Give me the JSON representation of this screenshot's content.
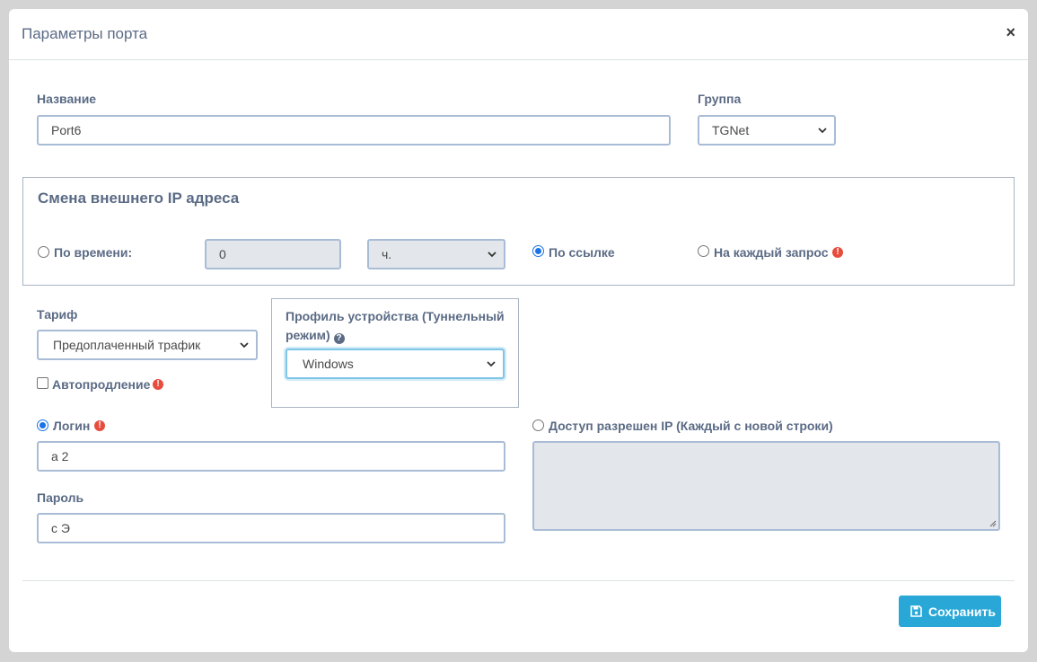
{
  "modal": {
    "title": "Параметры порта",
    "close_glyph": "×"
  },
  "name_field": {
    "label": "Название",
    "value": "Port6"
  },
  "group_field": {
    "label": "Группа",
    "selected": "TGNet"
  },
  "ip_change": {
    "title": "Смена внешнего IP адреса",
    "by_time_label": "По времени:",
    "time_value": "0",
    "time_unit_selected": "ч.",
    "by_link_label": "По ссылке",
    "per_request_label": "На каждый запрос",
    "selected_option": "by_link"
  },
  "tariff": {
    "label": "Тариф",
    "selected": "Предоплаченный трафик",
    "auto_renew_label": "Автопродление",
    "auto_renew_checked": false
  },
  "device_profile": {
    "label": "Профиль устройства (Туннельный режим)",
    "selected": "Windows"
  },
  "auth": {
    "login_label": "Логин",
    "login_value": "a          2",
    "password_label": "Пароль",
    "password_value": "c      Э",
    "ip_access_label": "Доступ разрешен IP (Каждый с новой строки)",
    "selected_mode": "login"
  },
  "footer": {
    "save_label": "Сохранить"
  },
  "colors": {
    "accent": "#29a8d8",
    "warning": "#e74c3c",
    "radio_checked": "#1a73e8"
  },
  "icons": {
    "close": "close-icon",
    "warning": "exclamation-circle-icon",
    "help": "question-circle-icon",
    "save": "floppy-disk-icon",
    "dropdown": "chevron-down-icon"
  }
}
